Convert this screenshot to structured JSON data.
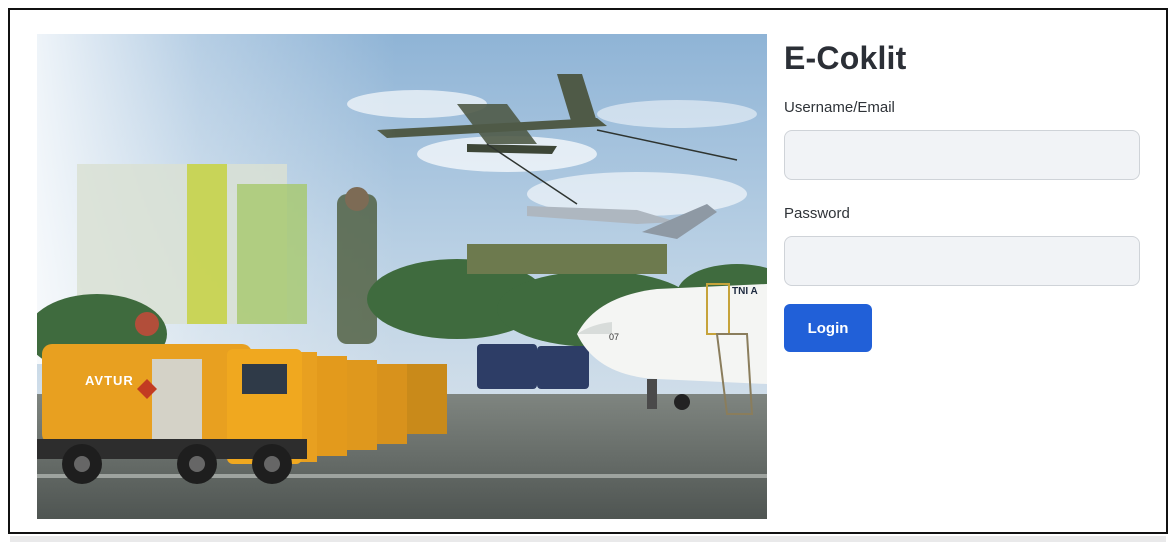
{
  "login": {
    "title": "E-Coklit",
    "username_label": "Username/Email",
    "username_value": "",
    "password_label": "Password",
    "password_value": "",
    "login_button": "Login"
  },
  "hero": {
    "truck_text": "AVTUR",
    "aircraft_text": "TNI A",
    "aircraft_number": "07"
  },
  "colors": {
    "accent": "#2160d8",
    "title": "#2b2f36",
    "input_bg": "#f1f3f6",
    "tanker_yellow": "#e39a1c"
  }
}
